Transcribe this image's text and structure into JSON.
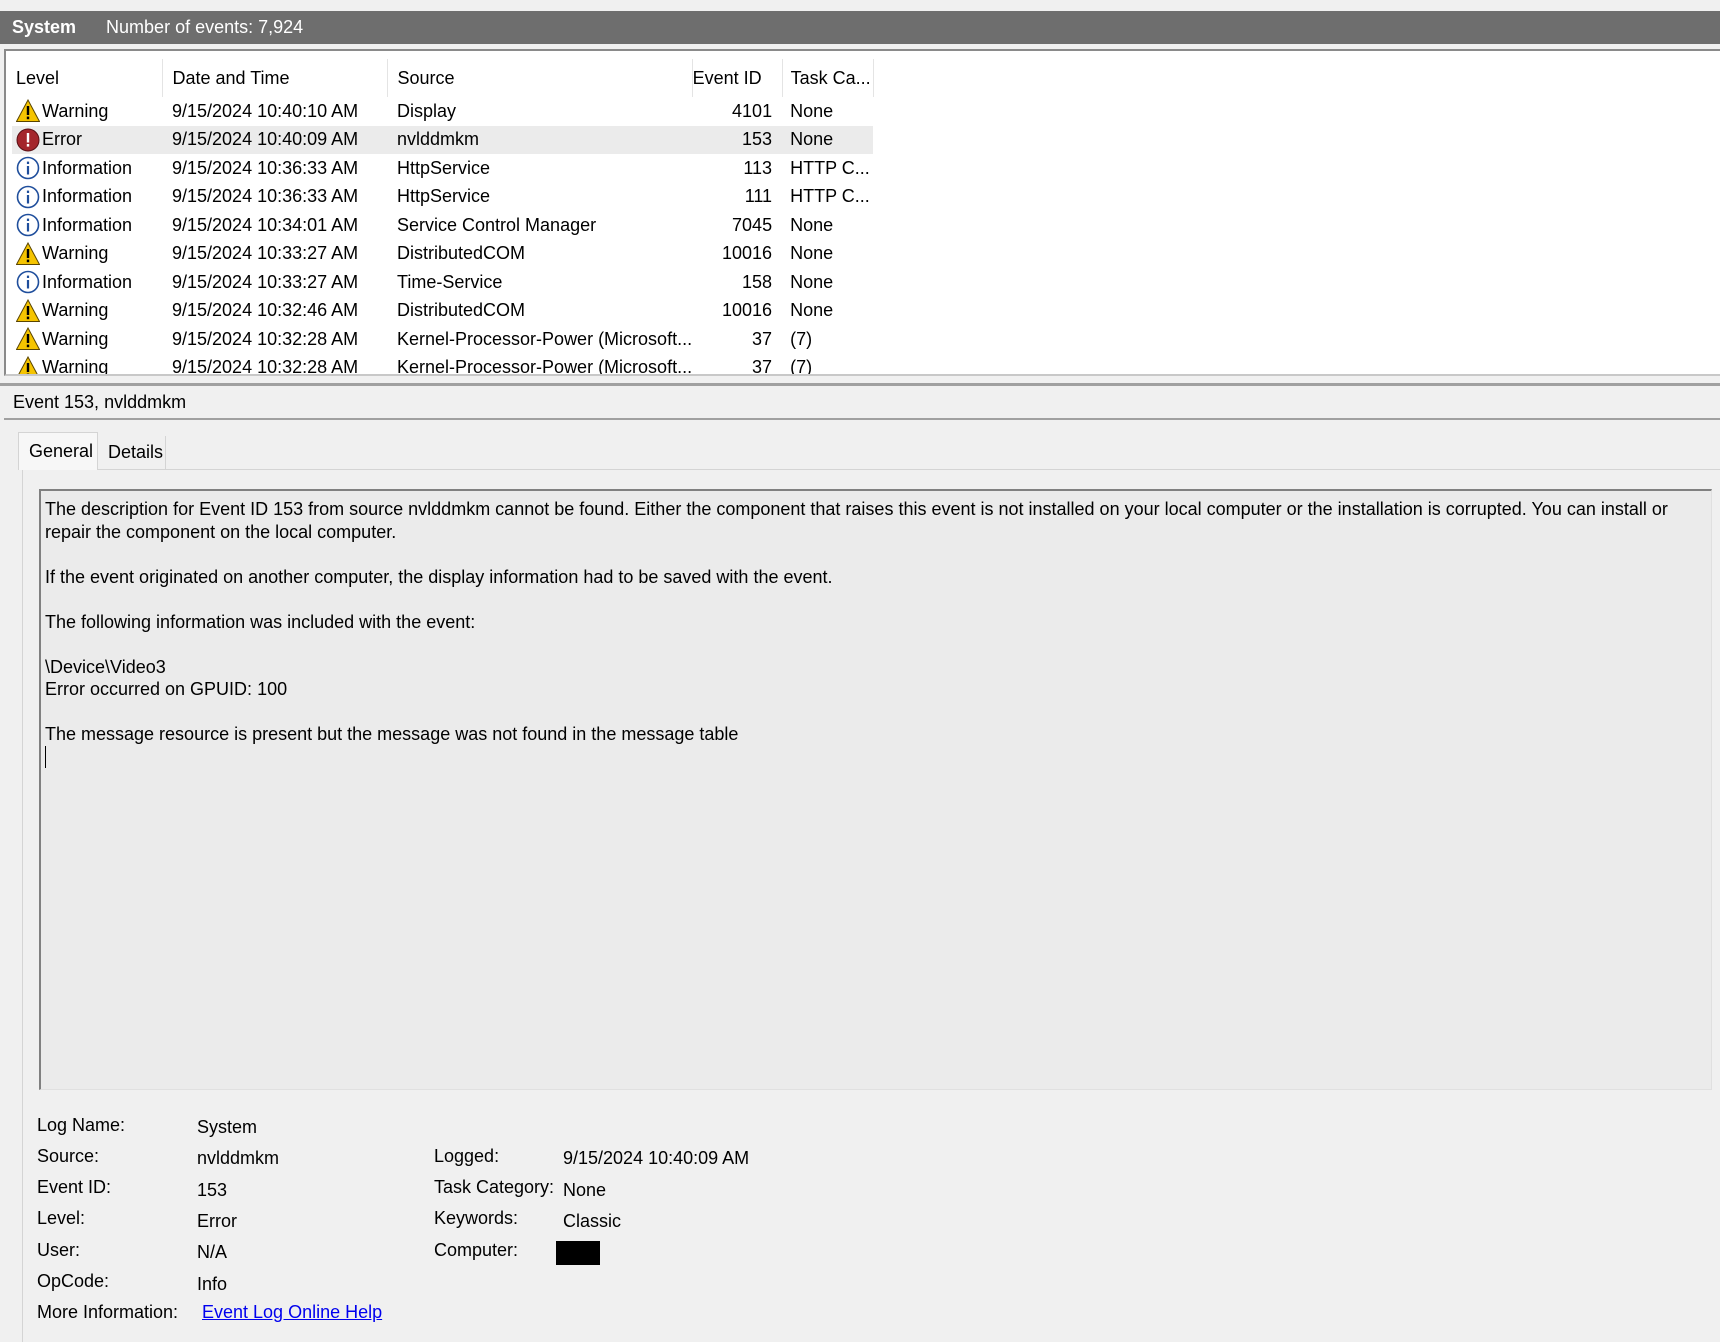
{
  "header": {
    "log_name": "System",
    "event_count": "Number of events: 7,924"
  },
  "columns": {
    "level": "Level",
    "date": "Date and Time",
    "source": "Source",
    "event_id": "Event ID",
    "task": "Task Ca..."
  },
  "events": [
    {
      "level": "Warning",
      "icon": "warning-icon",
      "date": "9/15/2024 10:40:10 AM",
      "source": "Display",
      "event_id": "4101",
      "task": "None"
    },
    {
      "level": "Error",
      "icon": "error-icon",
      "date": "9/15/2024 10:40:09 AM",
      "source": "nvlddmkm",
      "event_id": "153",
      "task": "None"
    },
    {
      "level": "Information",
      "icon": "info-icon",
      "date": "9/15/2024 10:36:33 AM",
      "source": "HttpService",
      "event_id": "113",
      "task": "HTTP C..."
    },
    {
      "level": "Information",
      "icon": "info-icon",
      "date": "9/15/2024 10:36:33 AM",
      "source": "HttpService",
      "event_id": "111",
      "task": "HTTP C..."
    },
    {
      "level": "Information",
      "icon": "info-icon",
      "date": "9/15/2024 10:34:01 AM",
      "source": "Service Control Manager",
      "event_id": "7045",
      "task": "None"
    },
    {
      "level": "Warning",
      "icon": "warning-icon",
      "date": "9/15/2024 10:33:27 AM",
      "source": "DistributedCOM",
      "event_id": "10016",
      "task": "None"
    },
    {
      "level": "Information",
      "icon": "info-icon",
      "date": "9/15/2024 10:33:27 AM",
      "source": "Time-Service",
      "event_id": "158",
      "task": "None"
    },
    {
      "level": "Warning",
      "icon": "warning-icon",
      "date": "9/15/2024 10:32:46 AM",
      "source": "DistributedCOM",
      "event_id": "10016",
      "task": "None"
    },
    {
      "level": "Warning",
      "icon": "warning-icon",
      "date": "9/15/2024 10:32:28 AM",
      "source": "Kernel-Processor-Power (Microsoft...",
      "event_id": "37",
      "task": "(7)"
    },
    {
      "level": "Warning",
      "icon": "warning-icon",
      "date": "9/15/2024 10:32:28 AM",
      "source": "Kernel-Processor-Power (Microsoft...",
      "event_id": "37",
      "task": "(7)"
    }
  ],
  "selected_row": 1,
  "detail": {
    "title": "Event 153, nvlddmkm",
    "tabs": [
      "General",
      "Details"
    ],
    "description": {
      "p1": "The description for Event ID 153 from source nvlddmkm cannot be found. Either the component that raises this event is not installed on your local computer or the installation is corrupted. You can install or repair the component on the local computer.",
      "p2": "If the event originated on another computer, the display information had to be saved with the event.",
      "p3": "The following information was included with the event:",
      "p4a": "\\Device\\Video3",
      "p4b": "Error occurred on GPUID: 100",
      "p5": "The message resource is present but the message was not found in the message table"
    },
    "props": {
      "log_name_label": "Log Name:",
      "log_name": "System",
      "source_label": "Source:",
      "source": "nvlddmkm",
      "event_id_label": "Event ID:",
      "event_id": "153",
      "level_label": "Level:",
      "level": "Error",
      "user_label": "User:",
      "user": "N/A",
      "opcode_label": "OpCode:",
      "opcode": "Info",
      "more_info_label": "More Information:",
      "more_info_link": "Event Log Online Help",
      "logged_label": "Logged:",
      "logged": "9/15/2024 10:40:09 AM",
      "task_category_label": "Task Category:",
      "task_category": "None",
      "keywords_label": "Keywords:",
      "keywords": "Classic",
      "computer_label": "Computer:"
    }
  },
  "colors": {
    "header_bg": "#6e6e6e",
    "warning": "#f5c400",
    "error": "#a4262c",
    "info": "#1f4e9c",
    "link": "#0000ee"
  }
}
